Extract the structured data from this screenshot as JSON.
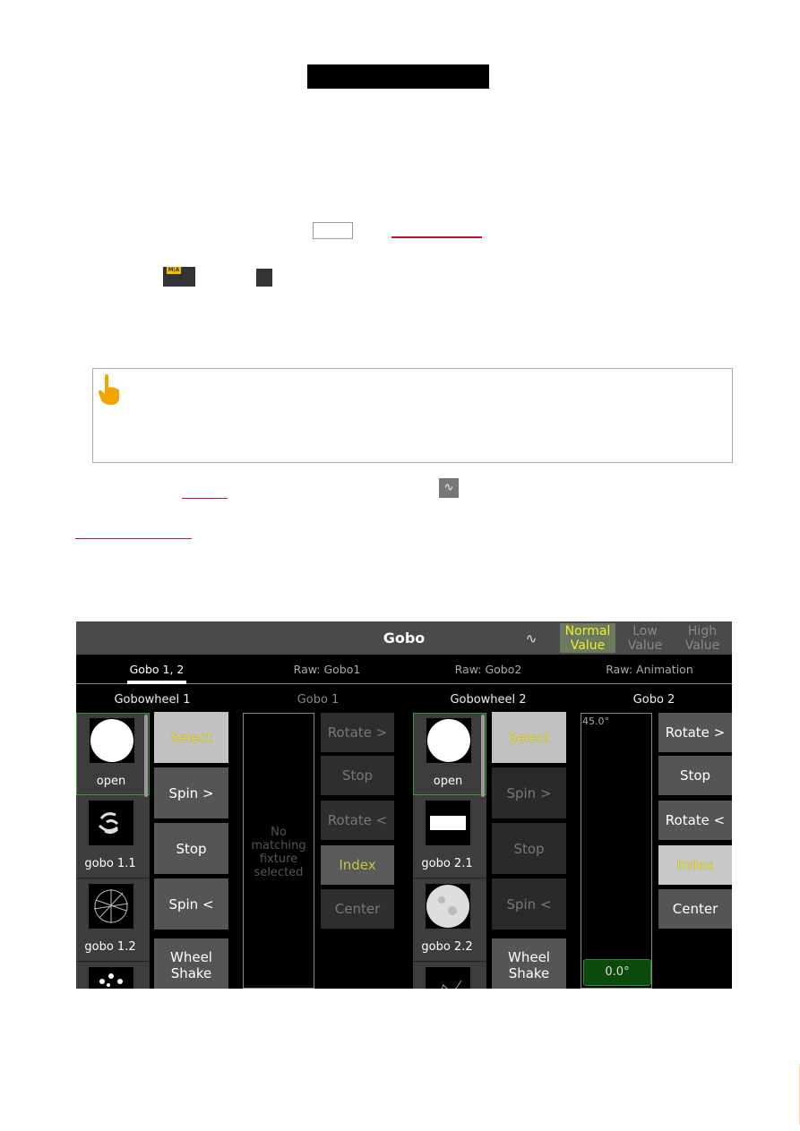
{
  "document": {
    "redacted_heading": "",
    "hint_icon": "pointing-hand-icon",
    "inline_keys": [
      "ma-key",
      "blank-key"
    ],
    "inline_icon": "waveform-icon"
  },
  "ui": {
    "title": "Gobo",
    "header_icon": "waveform-icon",
    "modes": [
      {
        "label": "Normal\nValue",
        "line1": "Normal",
        "line2": "Value",
        "active": true
      },
      {
        "label": "Low Value",
        "line1": "Low",
        "line2": "Value",
        "active": false
      },
      {
        "label": "High Value",
        "line1": "High",
        "line2": "Value",
        "active": false
      }
    ],
    "tabs": [
      {
        "label": "Gobo 1, 2",
        "active": true
      },
      {
        "label": "Raw: Gobo1",
        "active": false
      },
      {
        "label": "Raw: Gobo2",
        "active": false
      },
      {
        "label": "Raw: Animation",
        "active": false
      }
    ],
    "columns": {
      "wheel1": "Gobowheel 1",
      "gobo1": "Gobo 1",
      "wheel2": "Gobowheel 2",
      "gobo2": "Gobo 2"
    },
    "wheel1_items": [
      "open",
      "gobo 1.1",
      "gobo 1.2"
    ],
    "wheel2_items": [
      "open",
      "gobo 2.1",
      "gobo 2.2"
    ],
    "wheel1_buttons": [
      "Select",
      "Spin >",
      "Stop",
      "Spin <",
      "Wheel Shake"
    ],
    "wheel2_buttons": [
      "Select",
      "Spin >",
      "Stop",
      "Spin <",
      "Wheel Shake"
    ],
    "gobo1_buttons": [
      "Rotate >",
      "Stop",
      "Rotate <",
      "Index",
      "Center"
    ],
    "gobo2_buttons": [
      "Rotate >",
      "Stop",
      "Rotate <",
      "Index",
      "Center"
    ],
    "gobo1_message": "No matching fixture selected",
    "gobo2_fader": {
      "max_label": "45.0°",
      "value": "0.0°"
    },
    "colors": {
      "accent_yellow": "#e9e12e",
      "selected_green": "#2fa02f",
      "value_green": "#0a4a0a"
    }
  }
}
